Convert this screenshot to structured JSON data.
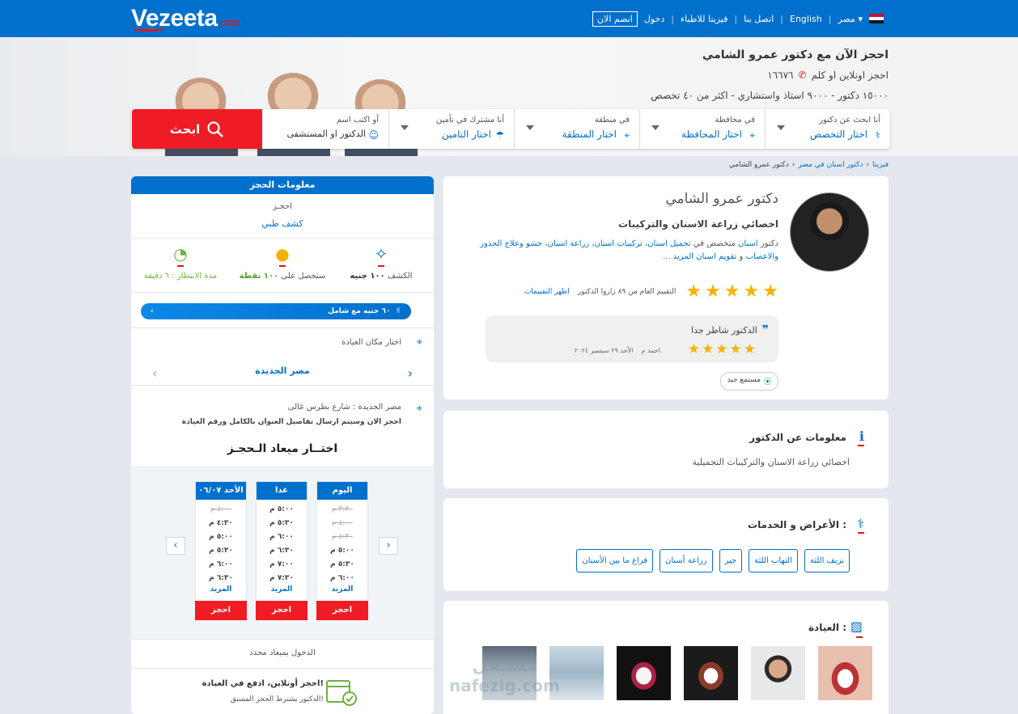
{
  "header": {
    "logo": "Vezeeta",
    "logo_suffix": ".com",
    "nav": [
      {
        "label": "مصر",
        "name": "country-select"
      },
      {
        "label": "English",
        "name": "language-link"
      },
      {
        "label": "اتصل بنا",
        "name": "contact-link"
      },
      {
        "label": "فيزيتا للاطباء",
        "name": "doctors-link"
      },
      {
        "label": "دخول",
        "name": "login-link"
      },
      {
        "label": "انضم الان",
        "name": "join-button"
      }
    ]
  },
  "hero": {
    "title": "احجز الآن مع دكتور عمرو الشامي",
    "book_text": "احجز اونلاين او كلم",
    "phone": "١٦٦٧٦",
    "stats": "١٥٠٠٠ دكتور - ٩٠٠٠ استاذ واستشاري - اكثر من ٤٠ تخصص"
  },
  "search": {
    "fields": [
      {
        "label": "أنا ابحث عن دكتور",
        "value": "اختار التخصص",
        "icon": "stethoscope-icon"
      },
      {
        "label": "في محافظة",
        "value": "اختار المحافظة",
        "icon": "pin-icon"
      },
      {
        "label": "في منطقة",
        "value": "اختار المنطقة",
        "icon": "pin-icon"
      },
      {
        "label": "أنا مشترك في تأمين",
        "value": "اختار التامين",
        "icon": "umbrella-icon"
      },
      {
        "label": "أو اكتب اسم",
        "value": "الدكتور او المستشفى",
        "icon": "doctor-icon"
      }
    ],
    "button": "ابحث"
  },
  "breadcrumb": [
    "فيزيتا",
    "دكتور اسنان في مصر",
    "دكتور عمرو الشامي"
  ],
  "doctor": {
    "name": "دكتور عمرو الشامي",
    "specialty": "اخصائي زراعة الاسنان والتركيبات",
    "desc_prefix": "دكتور",
    "desc_link1": "اسنان",
    "desc_mid": "متخصص في",
    "desc_links": "تجميل اسنان، تركيبات اسنان، زراعة اسنان، حشو وعلاج الجذور والاعصاب",
    "desc_and": "و",
    "desc_link_last": "تقويم اسنان",
    "more": "المزيد ...",
    "rating_text": "التقييم العام من ٨٩ زاروا الدكتور",
    "show_ratings": "اظهر التقييمات",
    "review_text": "الدكتور شاطر جدا",
    "review_author": "احمد م.",
    "review_date": "الأحد ٢٩ سبتمبر ٢٠٢٤",
    "listener_badge": "مستمع جيد",
    "rating": 5
  },
  "info": {
    "title": "معلومات عن الدكتور",
    "text": "اخصائي زراعة الاسنان والتركيبات التجميلية"
  },
  "services": {
    "title": "الأعراض و الخدمات :",
    "tags": [
      "نزيف اللثة",
      "التهاب اللثة",
      "جير",
      "زراعة أسنان",
      "فراغ ما بين الأسنان"
    ]
  },
  "clinic": {
    "title": "العيادة :"
  },
  "booking": {
    "header": "معلومات الحجز",
    "type_label": "احجـز",
    "type_value": "كشف طبي",
    "fee_label": "الكشف",
    "fee_value": "١٠٠ جنيه",
    "points_label": "ستحصل على",
    "points_value": "١٠٠ نقطة",
    "wait_label": "مدة الانتظار :",
    "wait_value": "٦ دقيقة",
    "promo": "٦٠ جنيه مع شامل",
    "choose_clinic": "اختار مكان العيادة",
    "clinic_area": "مصر الجديدة",
    "address": "مصر الجديدة : شارع بطرس غالى",
    "address_note": "احجز الان وسيتم ارسال تفاصيل العنوان بالكامل ورقم العيادة",
    "choose_time": "اختــار ميعاد الـحجـز",
    "days": [
      {
        "label": "اليوم",
        "times": [
          "٣:٣٠ م",
          "٤:٠٠ م",
          "٤:٣٠ م",
          "٥:٠٠ م",
          "٥:٣٠ م",
          "٦:٠٠ م"
        ],
        "off": [
          true,
          true,
          true,
          false,
          false,
          false
        ]
      },
      {
        "label": "غدا",
        "times": [
          "٥:٠٠ م",
          "٥:٣٠ م",
          "٦:٠٠ م",
          "٦:٣٠ م",
          "٧:٠٠ م",
          "٧:٣٠ م"
        ],
        "off": [
          false,
          false,
          false,
          false,
          false,
          false
        ]
      },
      {
        "label": "الأحد ٠٦/٠٧",
        "times": [
          "٤:٠٠ م",
          "٤:٣٠ م",
          "٥:٠٠ م",
          "٥:٣٠ م",
          "٦:٠٠ م",
          "٦:٣٠ م"
        ],
        "off": [
          true,
          false,
          false,
          false,
          false,
          false
        ]
      }
    ],
    "more_label": "المزيد",
    "book_button": "احجز",
    "fixed_entry": "الدخول بميعاد محدد",
    "pay_title": "احجز أونلاين، ادفع في العيادة!",
    "pay_note": "الدكتور يشترط الحجز المسبق!"
  },
  "watermark": {
    "line1": "مستقل",
    "line2": "nafezig.com"
  },
  "colors": {
    "primary": "#0070cd",
    "accent": "#ef1c24",
    "star": "#f6b400"
  }
}
